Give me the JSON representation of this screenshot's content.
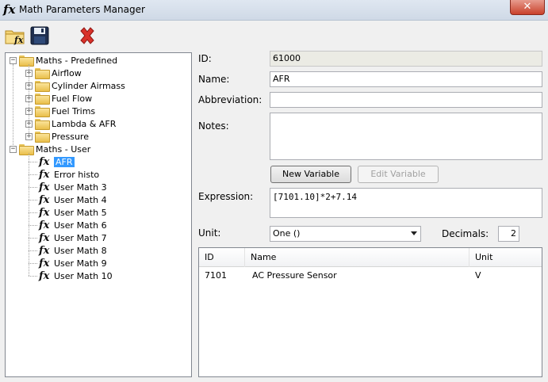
{
  "window": {
    "title": "Math Parameters Manager",
    "icon": "fx",
    "close_label": "✕"
  },
  "toolbar": {
    "new_icon": "folder-fx-icon",
    "save_icon": "save-disk-icon",
    "delete_icon": "red-x-icon"
  },
  "tree": {
    "predefined": {
      "label": "Maths - Predefined",
      "children": [
        "Airflow",
        "Cylinder Airmass",
        "Fuel Flow",
        "Fuel Trims",
        "Lambda & AFR",
        "Pressure"
      ]
    },
    "user": {
      "label": "Maths - User",
      "children": [
        "AFR",
        "Error histo",
        "User Math 3",
        "User Math 4",
        "User Math 5",
        "User Math 6",
        "User Math 7",
        "User Math 8",
        "User Math 9",
        "User Math 10"
      ],
      "selected": "AFR"
    },
    "fx_glyph": "fx"
  },
  "form": {
    "id_label": "ID:",
    "id_value": "61000",
    "name_label": "Name:",
    "name_value": "AFR",
    "abbr_label": "Abbreviation:",
    "abbr_value": "",
    "notes_label": "Notes:",
    "notes_value": "",
    "new_variable": "New Variable",
    "edit_variable": "Edit Variable",
    "expression_label": "Expression:",
    "expression_value": "[7101.10]*2+7.14",
    "unit_label": "Unit:",
    "unit_value": "One ()",
    "decimals_label": "Decimals:",
    "decimals_value": "2"
  },
  "variables": {
    "columns": [
      "ID",
      "Name",
      "Unit"
    ],
    "rows": [
      {
        "id": "7101",
        "name": "AC Pressure Sensor",
        "unit": "V"
      }
    ]
  }
}
